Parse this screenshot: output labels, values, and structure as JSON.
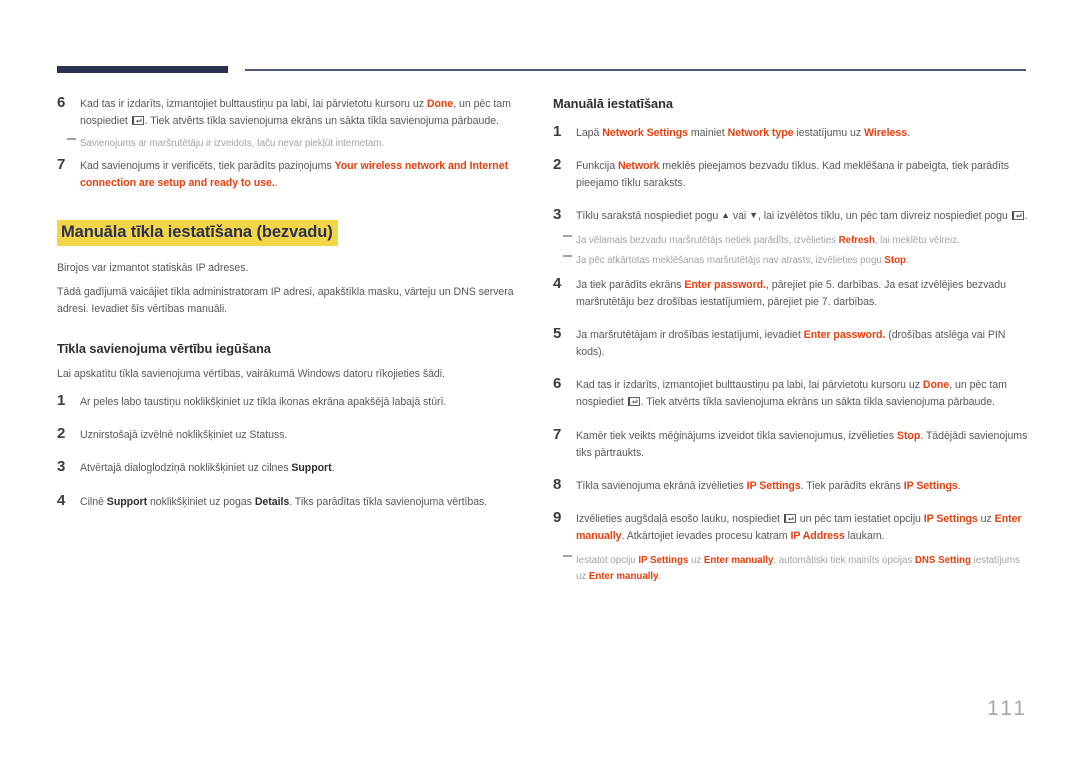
{
  "colors": {
    "navy_rule": "#2b3050",
    "thin_rule": "#55557a",
    "accent_red": "#e8400f",
    "highlight_yellow": "#f2d648",
    "body_text": "#59595b",
    "note_gray": "#a3a3a5",
    "page_number_gray": "#a8a8aa"
  },
  "page_number": "111",
  "icons": {
    "enter_key": "enter-key-icon",
    "arrow_up": "▲",
    "arrow_down": "▼"
  },
  "left_column": {
    "steps_top": [
      {
        "number": "6",
        "segments": [
          {
            "t": "Kad tas ir izdarīts, izmantojiet bulttaustiņu pa labi, lai pārvietotu kursoru uz ",
            "s": "n"
          },
          {
            "t": "Done",
            "s": "r"
          },
          {
            "t": ", un pēc tam nospiediet ",
            "s": "n"
          },
          {
            "t": "",
            "s": "key"
          },
          {
            "t": ". Tiek atvērts tīkla savienojuma ekrāns un sākta tīkla savienojuma pārbaude.",
            "s": "n"
          }
        ]
      }
    ],
    "note_after_step6": [
      {
        "t": "Savienojums ar maršrutētāju ir izveidots, taču nevar piekļūt internetam.",
        "s": "n"
      }
    ],
    "steps_after_note": [
      {
        "number": "7",
        "segments": [
          {
            "t": "Kad savienojums ir verificēts, tiek parādīts paziņojums ",
            "s": "n"
          },
          {
            "t": "Your wireless network and Internet connection are setup and ready to use.",
            "s": "r"
          },
          {
            "t": ".",
            "s": "n"
          }
        ]
      }
    ],
    "heading_highlight": "Manuāla tīkla iestatīšana (bezvadu)",
    "intro_paragraphs": [
      "Birojos var izmantot statiskās IP adreses.",
      "Tādā gadījumā vaicājiet tīkla administratoram IP adresi, apakštīkla masku, vārteju un DNS servera adresi. Ievadiet šīs vērtības manuāli."
    ],
    "subheading": "Tīkla savienojuma vērtību iegūšana",
    "subintro": "Lai apskatītu tīkla savienojuma vērtības, vairākumā Windows datoru rīkojieties šādi.",
    "steps_bottom": [
      {
        "number": "1",
        "segments": [
          {
            "t": "Ar peles labo taustiņu noklikšķiniet uz tīkla ikonas ekrāna apakšējā labajā stūrī.",
            "s": "n"
          }
        ]
      },
      {
        "number": "2",
        "segments": [
          {
            "t": "Uznirstošajā izvēlnē noklikšķiniet uz Statuss.",
            "s": "n"
          }
        ]
      },
      {
        "number": "3",
        "segments": [
          {
            "t": "Atvērtajā dialoglodziņā noklikšķiniet uz cilnes ",
            "s": "n"
          },
          {
            "t": "Support",
            "s": "b"
          },
          {
            "t": ".",
            "s": "n"
          }
        ]
      },
      {
        "number": "4",
        "segments": [
          {
            "t": "Cilnē ",
            "s": "n"
          },
          {
            "t": "Support",
            "s": "b"
          },
          {
            "t": " noklikšķiniet uz pogas ",
            "s": "n"
          },
          {
            "t": "Details",
            "s": "b"
          },
          {
            "t": ". Tiks parādītas tīkla savienojuma vērtības.",
            "s": "n"
          }
        ]
      }
    ]
  },
  "right_column": {
    "heading": "Manuālā iestatīšana",
    "blocks": [
      {
        "kind": "step",
        "number": "1",
        "segments": [
          {
            "t": "Lapā ",
            "s": "n"
          },
          {
            "t": "Network Settings",
            "s": "r"
          },
          {
            "t": " mainiet ",
            "s": "n"
          },
          {
            "t": "Network type",
            "s": "r"
          },
          {
            "t": " iestatījumu uz ",
            "s": "n"
          },
          {
            "t": "Wireless",
            "s": "r"
          },
          {
            "t": ".",
            "s": "n"
          }
        ]
      },
      {
        "kind": "step",
        "number": "2",
        "segments": [
          {
            "t": "Funkcija ",
            "s": "n"
          },
          {
            "t": "Network",
            "s": "r"
          },
          {
            "t": " meklēs pieejamos bezvadu tīklus. Kad meklēšana ir pabeigta, tiek parādīts pieejamo tīklu saraksts.",
            "s": "n"
          }
        ]
      },
      {
        "kind": "step",
        "number": "3",
        "segments": [
          {
            "t": "Tīklu sarakstā nospiediet pogu ",
            "s": "n"
          },
          {
            "t": "▲",
            "s": "tri"
          },
          {
            "t": " vai ",
            "s": "n"
          },
          {
            "t": "▼",
            "s": "tri"
          },
          {
            "t": ", lai izvēlētos tīklu, un pēc tam divreiz nospiediet pogu ",
            "s": "n"
          },
          {
            "t": "",
            "s": "key"
          },
          {
            "t": ".",
            "s": "n"
          }
        ]
      },
      {
        "kind": "note",
        "segments": [
          {
            "t": "Ja vēlamais bezvadu maršrutētājs netiek parādīts, izvēlieties ",
            "s": "n"
          },
          {
            "t": "Refresh",
            "s": "r"
          },
          {
            "t": ", lai meklētu vēlreiz.",
            "s": "n"
          }
        ]
      },
      {
        "kind": "note",
        "segments": [
          {
            "t": "Ja pēc atkārtotas meklēšanas maršrutētājs nav atrasts, izvēlieties pogu ",
            "s": "n"
          },
          {
            "t": "Stop",
            "s": "r"
          },
          {
            "t": ".",
            "s": "n"
          }
        ]
      },
      {
        "kind": "step",
        "number": "4",
        "segments": [
          {
            "t": "Ja tiek parādīts ekrāns ",
            "s": "n"
          },
          {
            "t": "Enter password.",
            "s": "r"
          },
          {
            "t": ", pārejiet pie 5. darbības. Ja esat izvēlējies bezvadu maršrutētāju bez drošības iestatījumiem, pārejiet pie 7. darbības.",
            "s": "n"
          }
        ]
      },
      {
        "kind": "step",
        "number": "5",
        "segments": [
          {
            "t": "Ja maršrutētājam ir drošības iestatījumi, ievadiet ",
            "s": "n"
          },
          {
            "t": "Enter password.",
            "s": "r"
          },
          {
            "t": " (drošības atslēga vai PIN kods).",
            "s": "n"
          }
        ]
      },
      {
        "kind": "step",
        "number": "6",
        "segments": [
          {
            "t": "Kad tas ir izdarīts, izmantojiet bulttaustiņu pa labi, lai pārvietotu kursoru uz ",
            "s": "n"
          },
          {
            "t": "Done",
            "s": "r"
          },
          {
            "t": ", un pēc tam nospiediet ",
            "s": "n"
          },
          {
            "t": "",
            "s": "key"
          },
          {
            "t": ". Tiek atvērts tīkla savienojuma ekrāns un sākta tīkla savienojuma pārbaude.",
            "s": "n"
          }
        ]
      },
      {
        "kind": "step",
        "number": "7",
        "segments": [
          {
            "t": "Kamēr tiek veikts mēģinājums izveidot tīkla savienojumus, izvēlieties ",
            "s": "n"
          },
          {
            "t": "Stop",
            "s": "r"
          },
          {
            "t": ". Tādējādi savienojums tiks pārtraukts.",
            "s": "n"
          }
        ]
      },
      {
        "kind": "step",
        "number": "8",
        "segments": [
          {
            "t": "Tīkla savienojuma ekrānā izvēlieties ",
            "s": "n"
          },
          {
            "t": "IP Settings",
            "s": "r"
          },
          {
            "t": ". Tiek parādīts ekrāns ",
            "s": "n"
          },
          {
            "t": "IP Settings",
            "s": "r"
          },
          {
            "t": ".",
            "s": "n"
          }
        ]
      },
      {
        "kind": "step",
        "number": "9",
        "segments": [
          {
            "t": "Izvēlieties augšdaļā esošo lauku, nospiediet ",
            "s": "n"
          },
          {
            "t": "",
            "s": "key"
          },
          {
            "t": " un pēc tam iestatiet opciju ",
            "s": "n"
          },
          {
            "t": "IP Settings",
            "s": "r"
          },
          {
            "t": " uz ",
            "s": "n"
          },
          {
            "t": "Enter manually",
            "s": "r"
          },
          {
            "t": ". Atkārtojiet ievades procesu katram ",
            "s": "n"
          },
          {
            "t": "IP Address",
            "s": "r"
          },
          {
            "t": " laukam.",
            "s": "n"
          }
        ]
      },
      {
        "kind": "note",
        "segments": [
          {
            "t": "Iestatot opciju ",
            "s": "n"
          },
          {
            "t": "IP Settings",
            "s": "r"
          },
          {
            "t": " uz ",
            "s": "n"
          },
          {
            "t": "Enter manually",
            "s": "r"
          },
          {
            "t": ", automātiski tiek mainīts opcijas ",
            "s": "n"
          },
          {
            "t": "DNS Setting",
            "s": "r"
          },
          {
            "t": " iestatījums uz ",
            "s": "n"
          },
          {
            "t": "Enter manually",
            "s": "r"
          },
          {
            "t": ".",
            "s": "n"
          }
        ]
      }
    ]
  }
}
